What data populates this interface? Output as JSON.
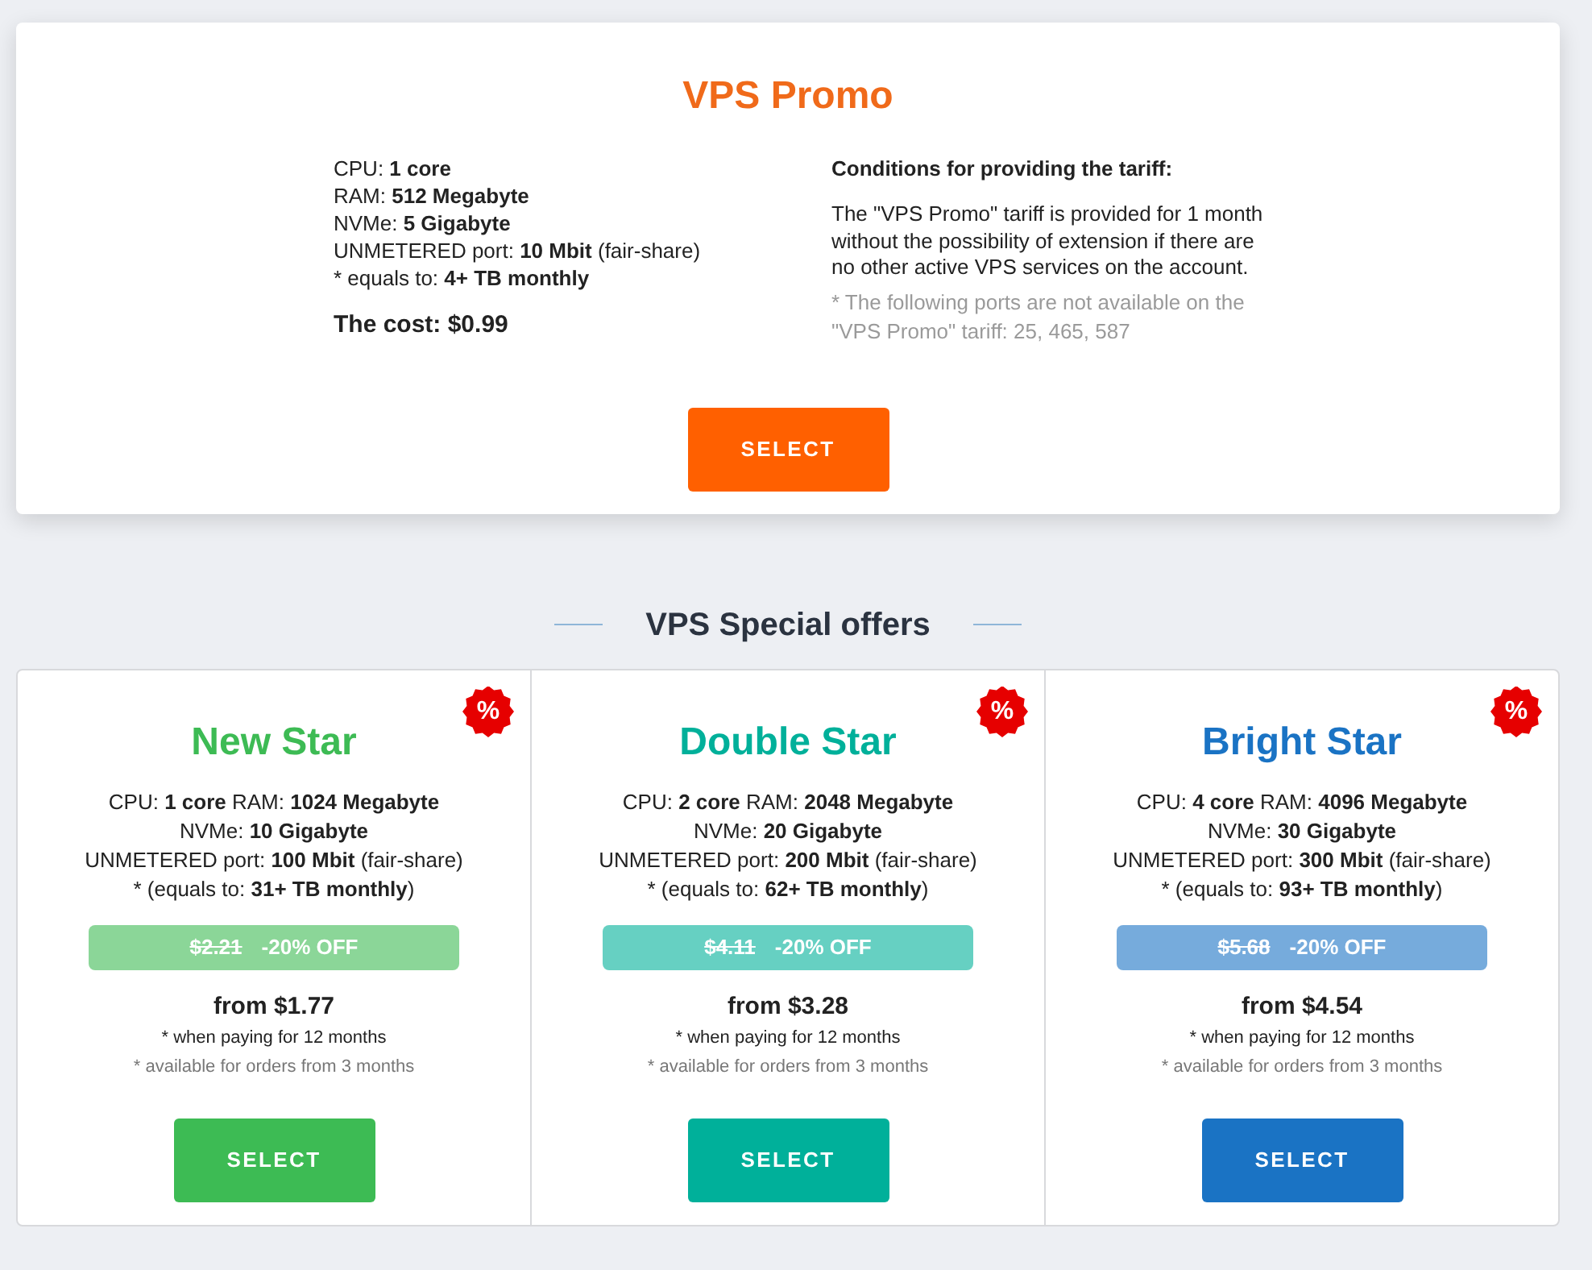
{
  "promo": {
    "title": "VPS Promo",
    "specs": [
      "CPU: **1 core**",
      "RAM: **512 Megabyte**",
      "NVMe: **5 Gigabyte**",
      "UNMETERED port: **10 Mbit** (fair-share)",
      "* equals to: **4+ TB monthly**"
    ],
    "cost": "The cost: $0.99",
    "conditions_title": "Conditions for providing the tariff:",
    "conditions_text": "The \"VPS Promo\" tariff is provided for 1 month without the possibility of extension if there are no other active VPS services on the account.",
    "ports_note": "* The following ports are not available on the \"VPS Promo\" tariff: 25, 465, 587",
    "button": "SELECT"
  },
  "special_offers": {
    "title": "VPS Special offers",
    "plans": [
      {
        "name": "New Star",
        "color": "#3dbb54",
        "badge": "%",
        "specs": [
          "CPU: **1 core** RAM: **1024 Megabyte**",
          "NVMe: **10 Gigabyte**",
          "UNMETERED port: **100 Mbit** (fair-share)",
          "* (equals to: **31+ TB monthly**)"
        ],
        "old_price": "$2.21",
        "discount": "-20% OFF",
        "price": "from $1.77",
        "payment_note": "* when paying for 12 months",
        "availability_note": "* available for orders from 3 months",
        "button": "SELECT"
      },
      {
        "name": "Double Star",
        "color": "#00b09a",
        "badge": "%",
        "specs": [
          "CPU: **2 core** RAM: **2048 Megabyte**",
          "NVMe: **20 Gigabyte**",
          "UNMETERED port: **200 Mbit** (fair-share)",
          "* (equals to: **62+ TB monthly**)"
        ],
        "old_price": "$4.11",
        "discount": "-20% OFF",
        "price": "from $3.28",
        "payment_note": "* when paying for 12 months",
        "availability_note": "* available for orders from 3 months",
        "button": "SELECT"
      },
      {
        "name": "Bright Star",
        "color": "#1a73c4",
        "badge": "%",
        "specs": [
          "CPU: **4 core** RAM: **4096 Megabyte**",
          "NVMe: **30 Gigabyte**",
          "UNMETERED port: **300 Mbit** (fair-share)",
          "* (equals to: **93+ TB monthly**)"
        ],
        "old_price": "$5.68",
        "discount": "-20% OFF",
        "price": "from $4.54",
        "payment_note": "* when paying for 12 months",
        "availability_note": "* available for orders from 3 months",
        "button": "SELECT"
      }
    ]
  }
}
